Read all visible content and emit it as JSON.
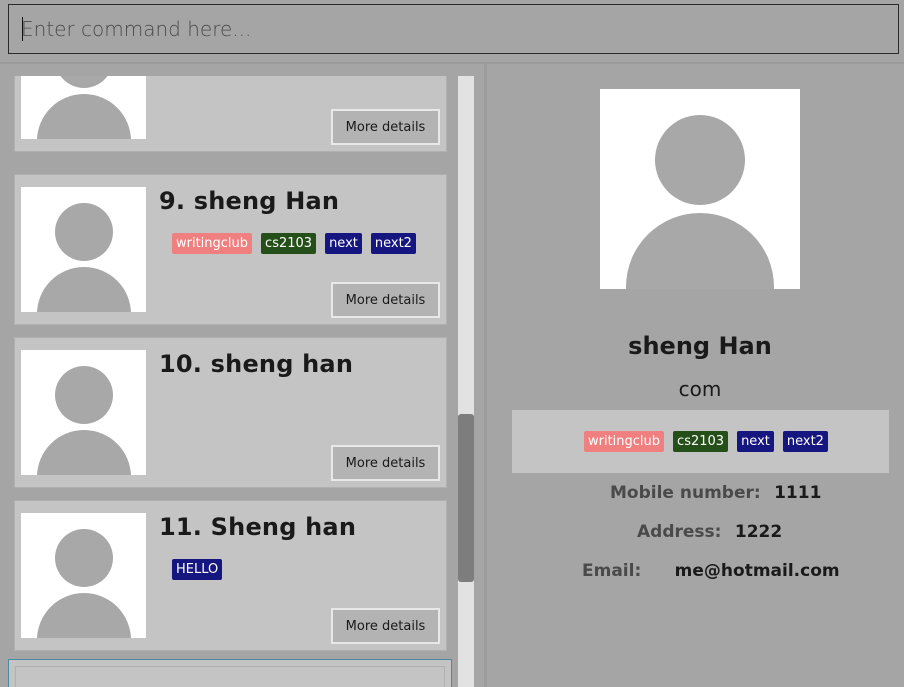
{
  "command": {
    "placeholder": "Enter command here..."
  },
  "list": {
    "more_label": "More details",
    "cards": [
      {
        "name": "",
        "tags": []
      },
      {
        "name": "9. sheng Han",
        "tags": [
          {
            "label": "writingclub",
            "color": "#f08080"
          },
          {
            "label": "cs2103",
            "color": "#254f19"
          },
          {
            "label": "next",
            "color": "#161680"
          },
          {
            "label": "next2",
            "color": "#161680"
          }
        ]
      },
      {
        "name": "10. sheng han",
        "tags": []
      },
      {
        "name": "11. Sheng han",
        "tags": [
          {
            "label": "HELLO",
            "color": "#161680"
          }
        ]
      }
    ]
  },
  "detail": {
    "name": "sheng Han",
    "subtitle": "com",
    "tags": [
      {
        "label": "writingclub",
        "color": "#f08080"
      },
      {
        "label": "cs2103",
        "color": "#254f19"
      },
      {
        "label": "next",
        "color": "#161680"
      },
      {
        "label": "next2",
        "color": "#161680"
      }
    ],
    "mobile_label": "Mobile number:",
    "mobile": "1111",
    "address_label": "Address:",
    "address": "1222",
    "email_label": "Email:",
    "email": "me@hotmail.com"
  },
  "colors": {
    "tag_pink": "#f08080",
    "tag_green": "#254f19",
    "tag_navy": "#161680"
  }
}
